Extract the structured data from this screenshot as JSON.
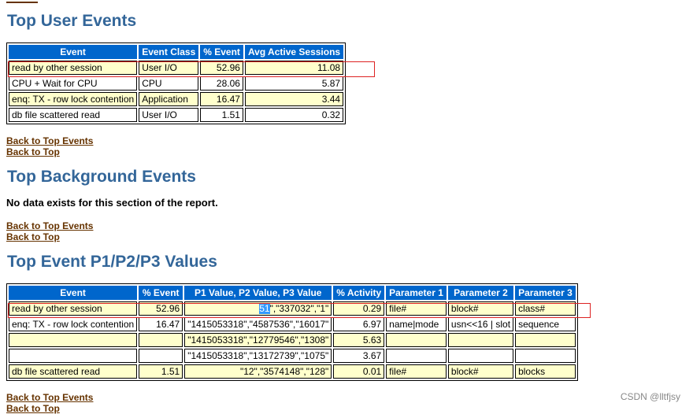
{
  "sections": {
    "user_events": {
      "title": "Top User Events",
      "headers": [
        "Event",
        "Event Class",
        "% Event",
        "Avg Active Sessions"
      ],
      "rows": [
        [
          "read by other session",
          "User I/O",
          "52.96",
          "11.08"
        ],
        [
          "CPU + Wait for CPU",
          "CPU",
          "28.06",
          "5.87"
        ],
        [
          "enq: TX - row lock contention",
          "Application",
          "16.47",
          "3.44"
        ],
        [
          "db file scattered read",
          "User I/O",
          "1.51",
          "0.32"
        ]
      ]
    },
    "background_events": {
      "title": "Top Background Events",
      "note": "No data exists for this section of the report."
    },
    "p123_values": {
      "title": "Top Event P1/P2/P3 Values",
      "headers": [
        "Event",
        "% Event",
        "P1 Value, P2 Value, P3 Value",
        "% Activity",
        "Parameter 1",
        "Parameter 2",
        "Parameter 3"
      ],
      "rows": [
        {
          "event": "read by other session",
          "pct_event": "52.96",
          "p_values_sel": "51",
          "p_values_rest": "\",\"337032\",\"1\"",
          "activity": "0.29",
          "param1": "file#",
          "param2": "block#",
          "param3": "class#"
        },
        {
          "event": "enq: TX - row lock contention",
          "pct_event": "16.47",
          "p_values": "\"1415053318\",\"4587536\",\"16017\"",
          "activity": "6.97",
          "param1": "name|mode",
          "param2": "usn<<16 | slot",
          "param3": "sequence"
        },
        {
          "event": "",
          "pct_event": "",
          "p_values": "\"1415053318\",\"12779546\",\"1308\"",
          "activity": "5.63",
          "param1": "",
          "param2": "",
          "param3": ""
        },
        {
          "event": "",
          "pct_event": "",
          "p_values": "\"1415053318\",\"13172739\",\"1075\"",
          "activity": "3.67",
          "param1": "",
          "param2": "",
          "param3": ""
        },
        {
          "event": "db file scattered read",
          "pct_event": "1.51",
          "p_values": "\"12\",\"3574148\",\"128\"",
          "activity": "0.01",
          "param1": "file#",
          "param2": "block#",
          "param3": "blocks"
        }
      ]
    }
  },
  "links": {
    "back_to_top_events": "Back to Top Events",
    "back_to_top": "Back to Top"
  },
  "watermark": "CSDN @lltfjsy",
  "colors": {
    "heading": "#336699",
    "header_bg": "#0066cc",
    "odd_row_bg": "#ffffcc",
    "link": "#663300",
    "annotation_box": "#dd2222"
  }
}
